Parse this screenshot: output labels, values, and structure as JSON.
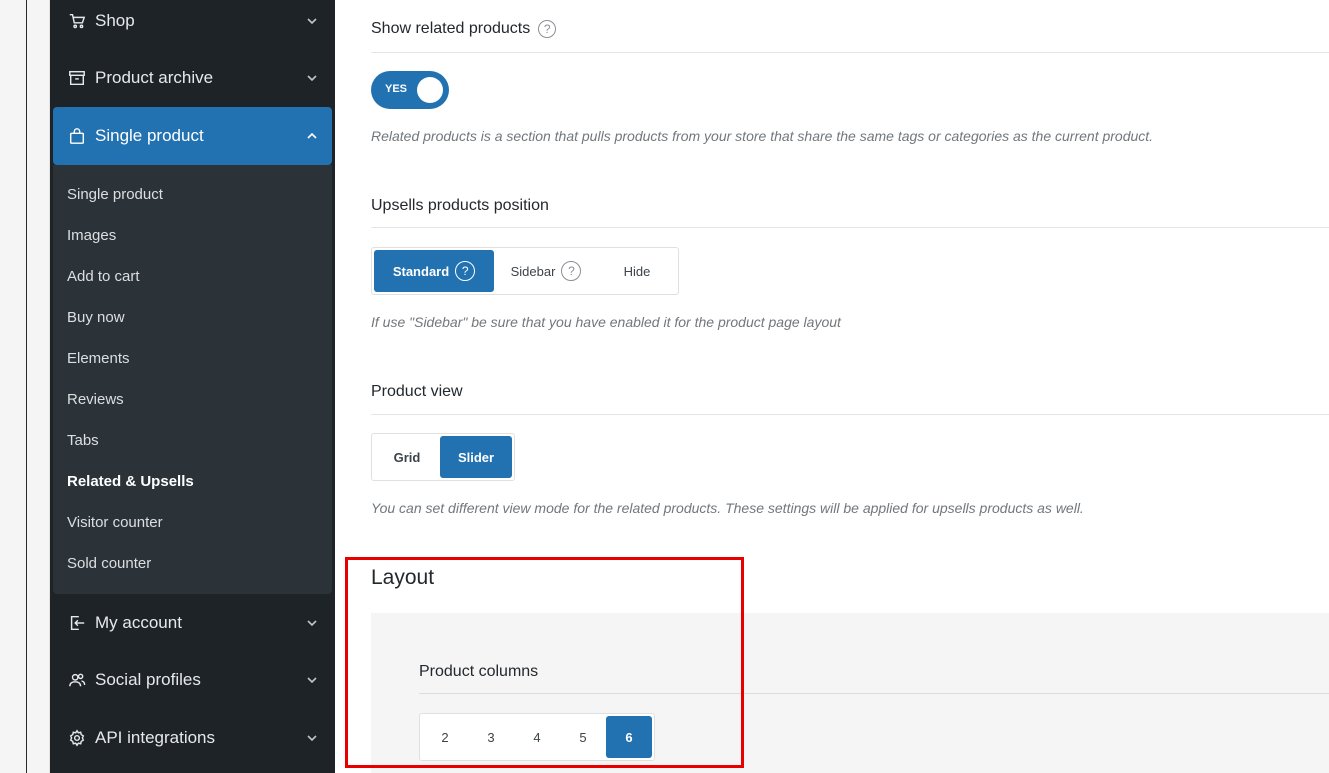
{
  "sidebar": {
    "items": [
      {
        "label": "Shop",
        "icon": "cart-icon"
      },
      {
        "label": "Product archive",
        "icon": "archive-icon"
      },
      {
        "label": "Single product",
        "icon": "bag-icon"
      },
      {
        "label": "My account",
        "icon": "login-icon"
      },
      {
        "label": "Social profiles",
        "icon": "users-icon"
      },
      {
        "label": "API integrations",
        "icon": "gear-icon"
      }
    ],
    "submenu": [
      "Single product",
      "Images",
      "Add to cart",
      "Buy now",
      "Elements",
      "Reviews",
      "Tabs",
      "Related & Upsells",
      "Visitor counter",
      "Sold counter"
    ],
    "current_sub": "Related & Upsells"
  },
  "main": {
    "related": {
      "title": "Show related products",
      "toggle_label": "YES",
      "toggle_on": true,
      "description": "Related products is a section that pulls products from your store that share the same tags or categories as the current product."
    },
    "upsells": {
      "title": "Upsells products position",
      "options": [
        "Standard",
        "Sidebar",
        "Hide"
      ],
      "selected": "Standard",
      "description": "If use \"Sidebar\" be sure that you have enabled it for the product page layout"
    },
    "view": {
      "title": "Product view",
      "options": [
        "Grid",
        "Slider"
      ],
      "selected": "Slider",
      "description": "You can set different view mode for the related products. These settings will be applied for upsells products as well."
    },
    "layout": {
      "title": "Layout",
      "columns_title": "Product columns",
      "columns": [
        "2",
        "3",
        "4",
        "5",
        "6"
      ],
      "selected": "6"
    },
    "help_glyph": "?"
  },
  "colors": {
    "accent": "#2271b1",
    "sidebar_bg": "#1d2327",
    "submenu_bg": "#2c3338",
    "highlight": "#e80000"
  }
}
